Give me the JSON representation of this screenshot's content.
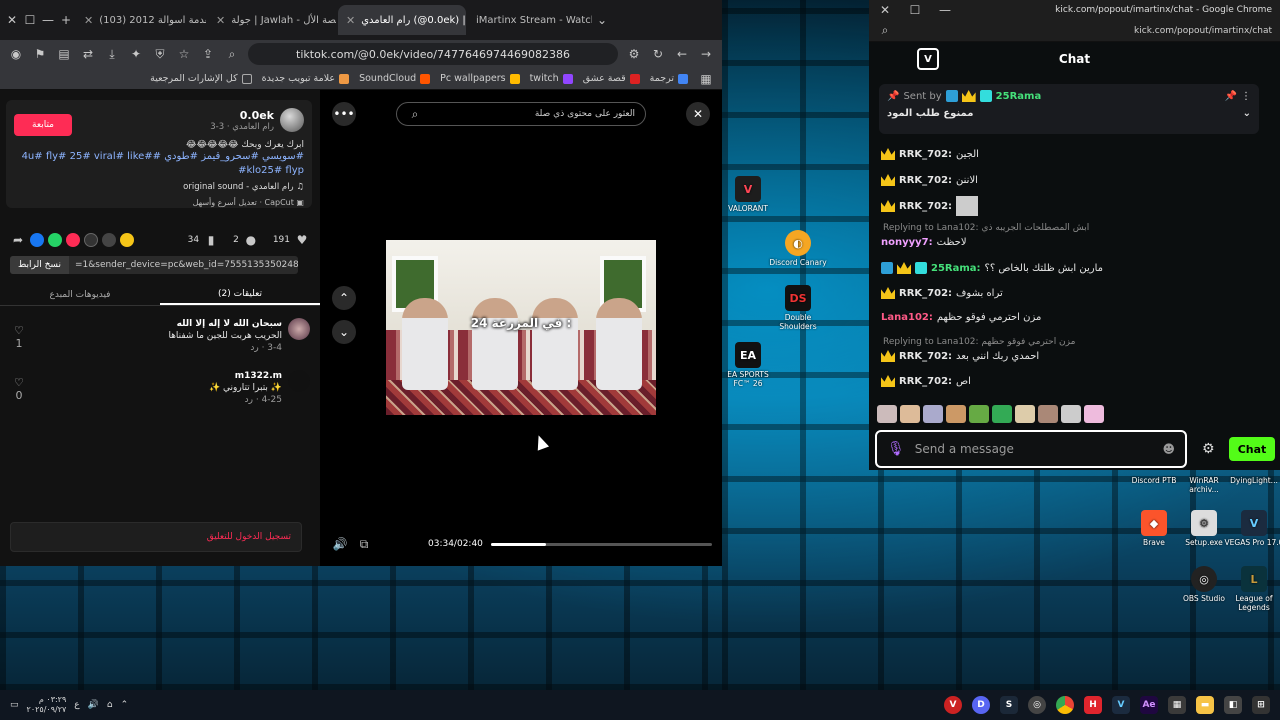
{
  "browser": {
    "tabs": [
      {
        "label": "iMartinx Stream - Watch",
        "active": false
      },
      {
        "label": "رام العامدي (@0.0ek) |",
        "active": true
      },
      {
        "label": "جولة | Jawlah - منصة الأل",
        "active": false
      },
      {
        "label": "(103) مقدمة اسوالة 2012",
        "active": false
      }
    ],
    "url": "tiktok.com/@0.0ek/video/7477646974469082386",
    "bookmarks": [
      "ترجمة",
      "قصة عشق",
      "twitch",
      "Pc wallpapers",
      "SoundCloud",
      "علامة تبويب جديدة",
      "كل الإشارات المرجعية"
    ]
  },
  "tiktok": {
    "username": "0.0ek",
    "subtitle": "رام العامدي · 3-3",
    "follow_label": "متابعة",
    "caption": "ابرك يعرك وبحك 😂😂😂😂😂",
    "hashtags": "#سويسي #سحرو_قيمز #طودي #4u# fly# 25# viral# like# klo25# flyp#",
    "sound": "رام العامدي - original sound",
    "capcut": "CapCut · تعديل أسرع وأسهل",
    "likes": "191",
    "comments": "2",
    "saves": "34",
    "link_text": "=1&sender_device=pc&web_id=7555135350248506881",
    "copy_label": "نسخ الرابط",
    "tab_comments": "(2) تعليقات",
    "tab_creator": "فيديوهات المبدع",
    "comment_list": [
      {
        "user": "سبحان الله لا إله إلا الله",
        "text": "الحريب هربت للجين ما شفناها",
        "date": "3-4",
        "likes": "1"
      },
      {
        "user": "m1322.m",
        "text": "✨ بتبرا تتاروني ✨",
        "date": "4-25",
        "likes": "0"
      }
    ],
    "login_prompt": "تسجيل الدخول للتعليق",
    "search_placeholder": "العثور على محتوى ذي صلة",
    "video_caption": "24 في المزرعة :",
    "time": "03:34/02:40",
    "progress": 0.25
  },
  "desktop": {
    "icons": [
      "VALORANT",
      "Discord Canary",
      "Double Shoulders",
      "EA SPORTS FC™ 26",
      "Discord PTB",
      "WinRAR archiv...",
      "DyingLight...",
      "Brave",
      "Setup.exe",
      "VEGAS Pro 17.0",
      "OBS Studio",
      "League of Legends"
    ]
  },
  "kick": {
    "window_title": "kick.com/popout/imartinx/chat - Google Chrome",
    "url": "kick.com/popout/imartinx/chat",
    "header": "Chat",
    "pinned_sent_by": "Sent by",
    "pinned_user": "25Rama",
    "pinned_text": "ممنوع طلب المود",
    "messages": [
      {
        "user": "RRK_702:",
        "text": "الجين"
      },
      {
        "user": "RRK_702:",
        "text": "الاننن"
      },
      {
        "user": "RRK_702:",
        "text": ""
      },
      {
        "reply": "Replying to Lana102: ابش المصطلحات الجريبه ذي",
        "user": "nonyyy7:",
        "text": "لاحظت"
      },
      {
        "user": "25Rama:",
        "text": "مارين ابش ظلتك بالخاص ؟؟"
      },
      {
        "user": "RRK_702:",
        "text": "تراه بشوف"
      },
      {
        "user": "Lana102:",
        "text": "مزن احترمي فوقو حظهم"
      },
      {
        "reply": "Replying to Lana102: مزن احترمي فوقو حظهم",
        "user": "RRK_702:",
        "text": "احمدي ربك انني بعد"
      },
      {
        "user": "RRK_702:",
        "text": "اص"
      }
    ],
    "input_placeholder": "Send a message",
    "chat_button": "Chat"
  },
  "taskbar": {
    "clock_time": "٠٣:٢٩ م",
    "clock_date": "٢٠٢٥/٠٩/٢٧",
    "lang": "ع"
  }
}
